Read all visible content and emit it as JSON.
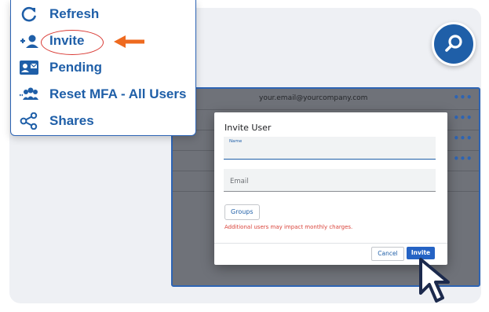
{
  "menu": {
    "items": [
      {
        "label": "Refresh",
        "icon": "refresh-icon"
      },
      {
        "label": "Invite",
        "icon": "add-user-icon"
      },
      {
        "label": "Pending",
        "icon": "pending-card-icon"
      },
      {
        "label": "Reset MFA - All Users",
        "icon": "users-icon"
      },
      {
        "label": "Shares",
        "icon": "share-icon"
      }
    ]
  },
  "app": {
    "email": "your.email@yourcompany.com",
    "more_label": "•••"
  },
  "modal": {
    "title": "Invite User",
    "name_label": "Name",
    "email_placeholder": "Email",
    "groups_label": "Groups",
    "warning": "Additional users may impact monthly charges.",
    "cancel_label": "Cancel",
    "invite_label": "Invite"
  },
  "colors": {
    "accent": "#1f5fa8",
    "primary_button": "#2563c4",
    "warning": "#d9433a",
    "highlight_arrow": "#ee6a1f",
    "highlight_oval": "#d93a34"
  }
}
